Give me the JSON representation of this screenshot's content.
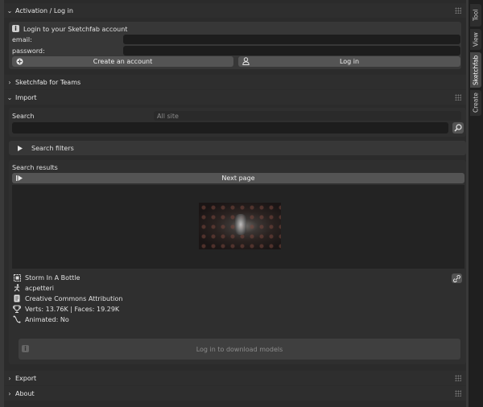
{
  "tabs": [
    "Tool",
    "View",
    "Sketchfab",
    "Create"
  ],
  "activation": {
    "title": "Activation / Log in",
    "info": "Login to your Sketchfab account",
    "email_label": "email:",
    "email_value": "",
    "password_label": "password:",
    "password_value": "",
    "create_label": "Create an account",
    "login_label": "Log in"
  },
  "teams": {
    "title": "Sketchfab for Teams"
  },
  "import": {
    "title": "Import",
    "search_label": "Search",
    "scope_value": "All site",
    "search_value": "",
    "filters_label": "Search filters",
    "results_label": "Search results",
    "next_label": "Next page"
  },
  "model": {
    "name": "Storm In A Bottle",
    "author": "acpetteri",
    "license": "Creative Commons Attribution",
    "stats": "Verts: 13.76K  |  Faces: 19.29K",
    "animated": "Animated: No",
    "download_label": "Log in to download models"
  },
  "export": {
    "title": "Export"
  },
  "about": {
    "title": "About"
  }
}
